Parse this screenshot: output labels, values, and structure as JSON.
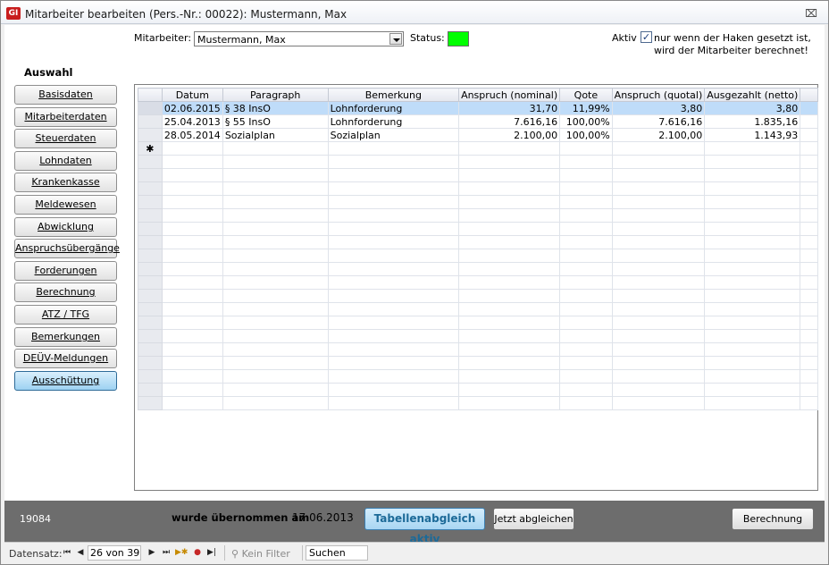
{
  "window": {
    "icon_text": "GI",
    "title": "Mitarbeiter bearbeiten (Pers.-Nr.: 00022): Mustermann, Max",
    "close_symbol": "⌧"
  },
  "header": {
    "employee_label": "Mitarbeiter:",
    "employee_value": "Mustermann, Max",
    "status_label": "Status:",
    "status_color": "#00ff00",
    "active_label": "Aktiv",
    "active_checked": true,
    "active_check_mark": "✓",
    "active_note_line1": "nur wenn der Haken gesetzt ist,",
    "active_note_line2": "wird der Mitarbeiter berechnet!"
  },
  "sidebar": {
    "heading": "Auswahl",
    "items": [
      {
        "label": "Basisdaten"
      },
      {
        "label": "Mitarbeiterdaten"
      },
      {
        "label": "Steuerdaten"
      },
      {
        "label": "Lohndaten"
      },
      {
        "label": "Krankenkasse"
      },
      {
        "label": "Meldewesen"
      },
      {
        "label": "Abwicklung"
      },
      {
        "label": "Anspruchsübergänge"
      },
      {
        "label": "Forderungen"
      },
      {
        "label": "Berechnung"
      },
      {
        "label": "ATZ / TFG"
      },
      {
        "label": "Bemerkungen"
      },
      {
        "label": "DEÜV-Meldungen"
      },
      {
        "label": "Ausschüttung"
      }
    ],
    "active_item": "Ausschüttung"
  },
  "table": {
    "columns": [
      "Datum",
      "Paragraph",
      "Bemerkung",
      "Anspruch (nominal)",
      "Qote",
      "Anspruch (quotal)",
      "Ausgezahlt (netto)"
    ],
    "rows": [
      [
        "02.06.2015",
        "§ 38 InsO",
        "Lohnforderung",
        "31,70",
        "11,99%",
        "3,80",
        "3,80"
      ],
      [
        "25.04.2013",
        "§ 55 InsO",
        "Lohnforderung",
        "7.616,16",
        "100,00%",
        "7.616,16",
        "1.835,16"
      ],
      [
        "28.05.2014",
        "Sozialplan",
        "Sozialplan",
        "2.100,00",
        "100,00%",
        "2.100,00",
        "1.143,93"
      ]
    ],
    "new_row_marker": "✱",
    "highlighted_row": 0
  },
  "footer": {
    "record_number": "19084",
    "uebernommen_label": "wurde übernommen am",
    "uebernommen_date": "17.06.2013",
    "table_sync_button": "Tabellenabgleich aktiv",
    "sync_now_button": "Jetzt abgleichen",
    "calc_button": "Berechnung"
  },
  "navigation": {
    "label": "Datensatz:",
    "record_position": "26 von 39",
    "filter_label": "Kein Filter",
    "search_placeholder": "Suchen"
  }
}
